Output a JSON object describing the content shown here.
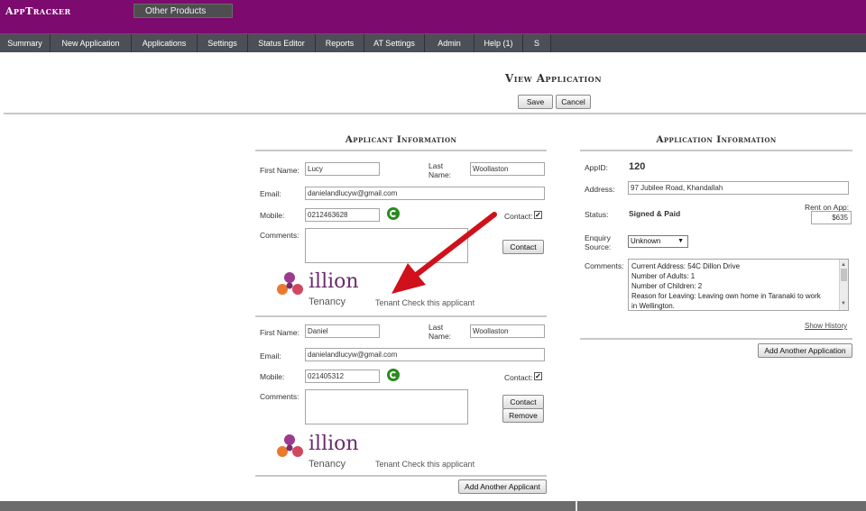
{
  "app": {
    "logo": "AppTracker",
    "other_products": "Other Products"
  },
  "nav": [
    {
      "label": "Summary"
    },
    {
      "label": "New Application"
    },
    {
      "label": "Applications"
    },
    {
      "label": "Settings"
    },
    {
      "label": "Status Editor"
    },
    {
      "label": "Reports"
    },
    {
      "label": "AT Settings"
    },
    {
      "label": "Admin"
    },
    {
      "label": "Help (1)"
    },
    {
      "label": "S"
    },
    {
      "label": ""
    }
  ],
  "page": {
    "title": "View Application",
    "save": "Save",
    "cancel": "Cancel"
  },
  "applicant_info": {
    "title": "Applicant Information",
    "labels": {
      "first_name": "First Name:",
      "last_name": "Last Name:",
      "email": "Email:",
      "mobile": "Mobile:",
      "comments": "Comments:",
      "contact_chk": "Contact:",
      "contact_btn": "Contact",
      "remove_btn": "Remove"
    },
    "tenant_check": "Tenant Check this applicant",
    "illion_word": "illion",
    "illion_sub": "Tenancy",
    "applicants": [
      {
        "first_name": "Lucy",
        "last_name": "Woollaston",
        "email": "danielandlucyw@gmail.com",
        "mobile": "0212463628",
        "contact": "✓"
      },
      {
        "first_name": "Daniel",
        "last_name": "Woollaston",
        "email": "danielandlucyw@gmail.com",
        "mobile": "021405312",
        "contact": "✓"
      }
    ],
    "add_applicant": "Add Another Applicant"
  },
  "application_info": {
    "title": "Application Information",
    "labels": {
      "appid": "AppID:",
      "address": "Address:",
      "status": "Status:",
      "rent": "Rent on App:",
      "enquiry_source": "Enquiry Source:",
      "comments": "Comments:"
    },
    "appid": "120",
    "address": "97 Jubilee Road, Khandallah",
    "status": "Signed & Paid",
    "rent": "$635",
    "enquiry_source": "Unknown",
    "comments_lines": [
      "Current Address: 54C Dillon Drive",
      "Number of Adults: 1",
      "Number of Children: 2",
      "Reason for Leaving: Leaving own home in Taranaki to work",
      "in Wellington."
    ],
    "show_history": "Show History",
    "add_application": "Add Another Application"
  },
  "colors": {
    "topbar": "#7d0a6e",
    "navbar": "#4b5057",
    "annotation_arrow": "#d0101a",
    "refresh_icon": "#2b8a1f"
  }
}
